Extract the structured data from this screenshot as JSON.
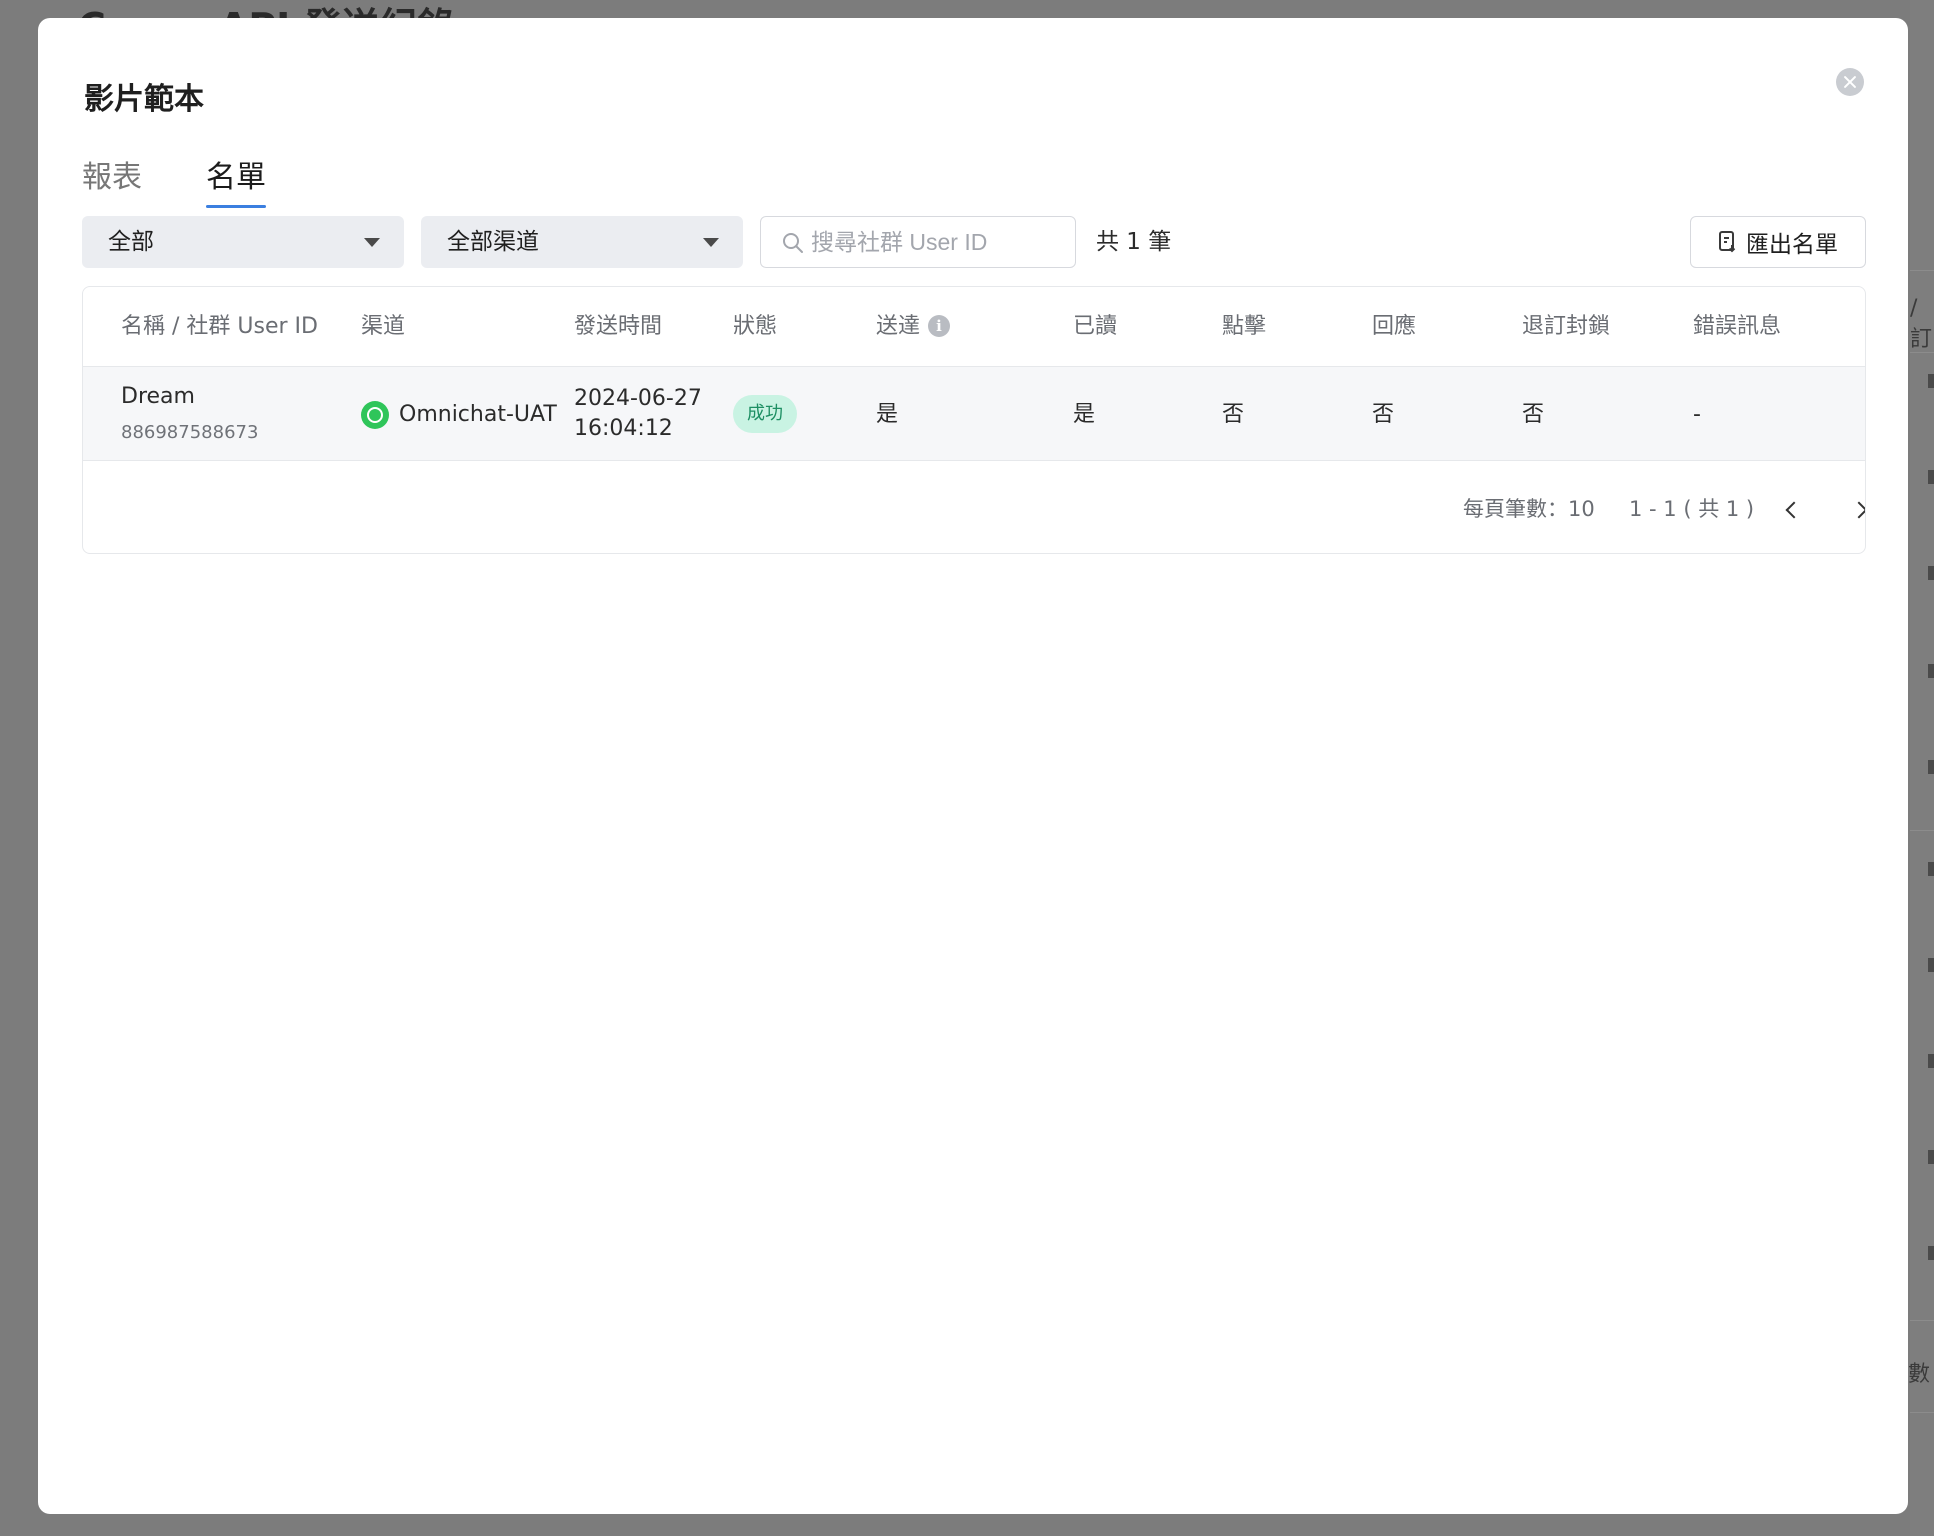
{
  "background": {
    "page_title": "Cease API 發送紀錄",
    "right_col_text": "/ 訂",
    "right_col_count": "數"
  },
  "modal": {
    "title": "影片範本",
    "tabs": [
      {
        "label": "報表",
        "active": false
      },
      {
        "label": "名單",
        "active": true
      }
    ],
    "filters": {
      "status_select": "全部",
      "channel_select": "全部渠道",
      "search_placeholder": "搜尋社群 User ID",
      "search_value": "",
      "total": "共 1 筆",
      "export_label": "匯出名單"
    },
    "table": {
      "columns": [
        "名稱 / 社群 User ID",
        "渠道",
        "發送時間",
        "狀態",
        "送達",
        "已讀",
        "點擊",
        "回應",
        "退訂封鎖",
        "錯誤訊息"
      ],
      "rows": [
        {
          "name": "Dream",
          "user_id": "886987588673",
          "channel": "Omnichat-UAT",
          "channel_icon": "whatsapp-icon",
          "sent_date": "2024-06-27",
          "sent_time": "16:04:12",
          "status": "成功",
          "delivered": "是",
          "read": "是",
          "clicked": "否",
          "replied": "否",
          "unsubscribed": "否",
          "error": "-"
        }
      ]
    },
    "pagination": {
      "per_page": "每頁筆數：10",
      "range": "1 - 1 ( 共 1 )"
    }
  },
  "colors": {
    "accent": "#3b7fe0",
    "success_bg": "#c9f3e3",
    "success_text": "#1d8f63",
    "whatsapp": "#2fc55a"
  }
}
